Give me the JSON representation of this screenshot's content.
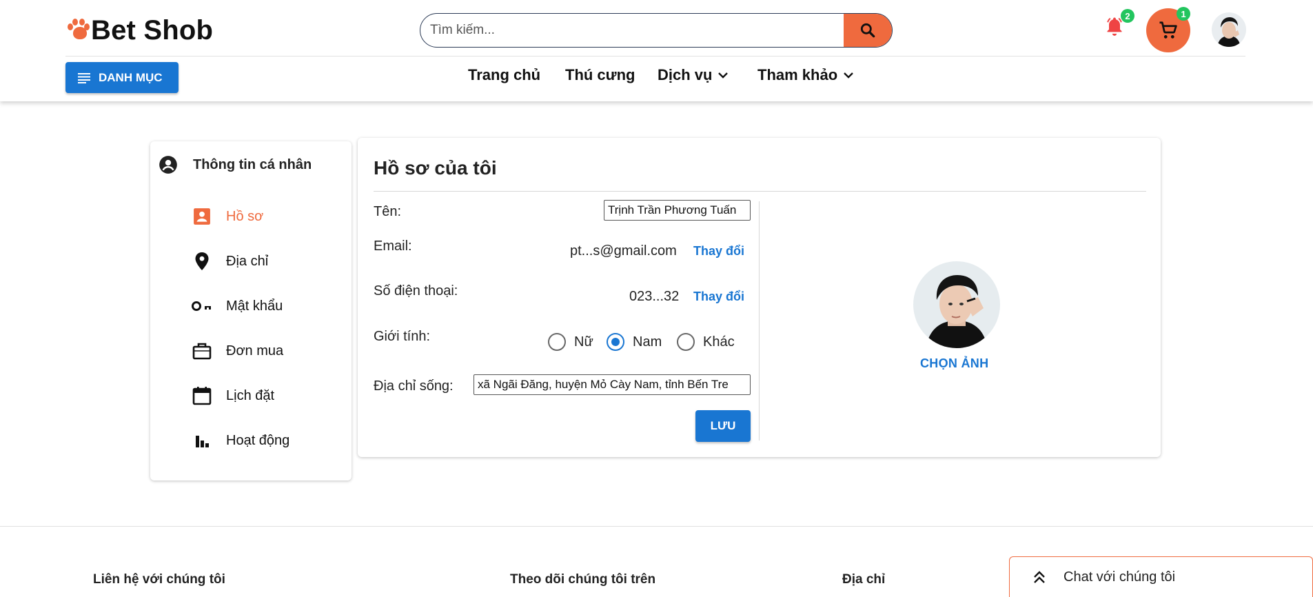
{
  "header": {
    "brand": "Bet Shob",
    "search_placeholder": "Tìm kiếm...",
    "notification_count": "2",
    "cart_count": "1",
    "category_button": "DANH MỤC",
    "nav": [
      {
        "label": "Trang chủ",
        "has_dropdown": false
      },
      {
        "label": "Thú cưng",
        "has_dropdown": false
      },
      {
        "label": "Dịch vụ",
        "has_dropdown": true
      },
      {
        "label": "Tham khảo",
        "has_dropdown": true
      }
    ]
  },
  "sidebar": {
    "title": "Thông tin cá nhân",
    "items": [
      {
        "label": "Hồ sơ",
        "icon": "profile-card-icon",
        "active": true
      },
      {
        "label": "Địa chỉ",
        "icon": "location-pin-icon",
        "active": false
      },
      {
        "label": "Mật khẩu",
        "icon": "key-icon",
        "active": false
      },
      {
        "label": "Đơn mua",
        "icon": "briefcase-icon",
        "active": false
      },
      {
        "label": "Lịch đặt",
        "icon": "calendar-icon",
        "active": false
      },
      {
        "label": "Hoạt động",
        "icon": "bar-chart-icon",
        "active": false
      }
    ]
  },
  "profile": {
    "heading": "Hồ sơ của tôi",
    "name_label": "Tên:",
    "name_value": "Trịnh Trần Phương Tuấn",
    "email_label": "Email:",
    "email_value": "pt...s@gmail.com",
    "phone_label": "Số điện thoại:",
    "phone_value": "023...32",
    "change_label": "Thay đổi",
    "gender_label": "Giới tính:",
    "gender_options": [
      "Nữ",
      "Nam",
      "Khác"
    ],
    "gender_selected": "Nam",
    "address_label": "Địa chỉ sống:",
    "address_value": "xã Ngãi Đăng, huyện Mỏ Cày Nam, tỉnh Bến Tre",
    "save_button": "LƯU",
    "choose_photo": "CHỌN ẢNH"
  },
  "footer": {
    "contact": "Liên hệ với chúng tôi",
    "follow": "Theo dõi chúng tôi trên",
    "address": "Địa chỉ",
    "chat": "Chat với chúng tôi"
  },
  "colors": {
    "accent_orange": "#ef6a3e",
    "primary_blue": "#1976d2",
    "badge_green": "#22c55e"
  }
}
